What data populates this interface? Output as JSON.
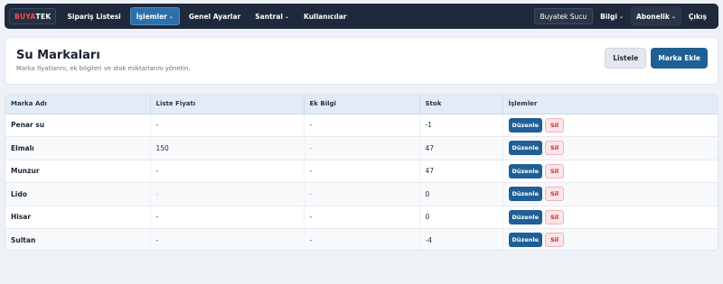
{
  "navbar": {
    "brand_a": "BUYA",
    "brand_b": "TEK",
    "items": [
      {
        "label": "Sipariş Listesi"
      },
      {
        "label": "İşlemler",
        "caret": "⌄"
      },
      {
        "label": "Genel Ayarlar"
      },
      {
        "label": "Santral",
        "caret": "⌄"
      },
      {
        "label": "Kullanıcılar"
      }
    ],
    "branch": "Buyatek Sucu",
    "info": {
      "label": "Bilgi",
      "caret": "⌄"
    },
    "subscription": {
      "label": "Abonelik",
      "caret": "⌄"
    },
    "logout": "Çıkış"
  },
  "header": {
    "title": "Su Markaları",
    "subtitle": "Marka fiyatlarını, ek bilgileri ve stok miktarlarını yönetin.",
    "list_button": "Listele",
    "add_button": "Marka Ekle"
  },
  "table": {
    "columns": [
      "Marka Adı",
      "Liste Fiyatı",
      "Ek Bilgi",
      "Stok",
      "İşlemler"
    ],
    "edit_label": "Düzenle",
    "delete_label": "Sil",
    "rows": [
      {
        "name": "Penar su",
        "price": "-",
        "info": "-",
        "stock": "-1"
      },
      {
        "name": "Elmalı",
        "price": "150",
        "info": "-",
        "stock": "47"
      },
      {
        "name": "Munzur",
        "price": "-",
        "info": "-",
        "stock": "47"
      },
      {
        "name": "Lido",
        "price": "-",
        "info": "-",
        "stock": "0"
      },
      {
        "name": "Hisar",
        "price": "-",
        "info": "-",
        "stock": "0"
      },
      {
        "name": "Sultan",
        "price": "-",
        "info": "-",
        "stock": "-4"
      }
    ]
  },
  "colors": {
    "navbar": "#1e2a3b",
    "primary": "#1f5f95",
    "brand_red": "#ff4b4b",
    "danger_bg": "#fde4e6"
  }
}
